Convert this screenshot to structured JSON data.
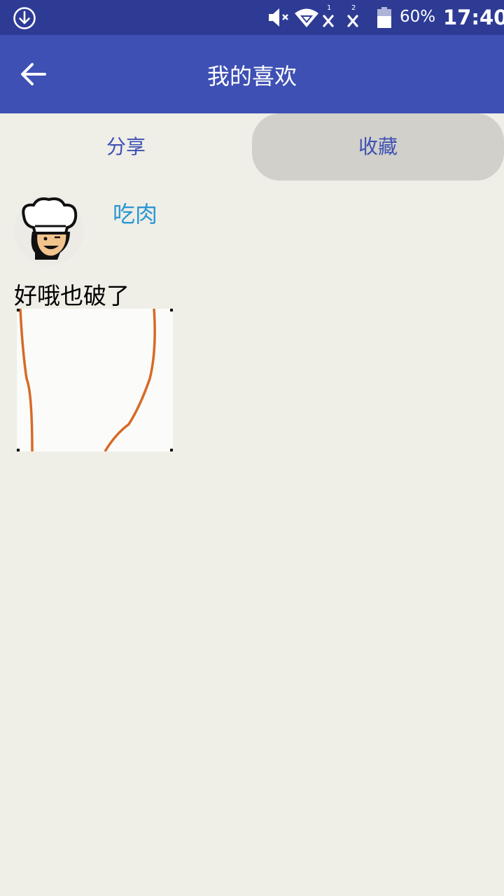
{
  "status_bar": {
    "battery_percent": "60%",
    "time": "17:40",
    "sim1_label": "1",
    "sim2_label": "2",
    "icons": [
      "download-icon",
      "volume-muted-icon",
      "wifi-icon",
      "signal-sim1-icon",
      "signal-sim2-icon",
      "battery-icon"
    ]
  },
  "app_bar": {
    "title": "我的喜欢",
    "back_icon": "arrow-left-icon"
  },
  "tabs": [
    {
      "label": "分享",
      "selected": false
    },
    {
      "label": "收藏",
      "selected": true
    }
  ],
  "post": {
    "username": "吃肉",
    "avatar_icon": "chef-avatar",
    "text": "好哦也破了"
  },
  "colors": {
    "status_bar": "#2e3b95",
    "app_bar": "#3e50b4",
    "background": "#efeee7",
    "tab_selected": "#d1d0ca",
    "tab_text": "#3e50b4",
    "username": "#2a97d4",
    "drawing_stroke": "#d76a25"
  }
}
